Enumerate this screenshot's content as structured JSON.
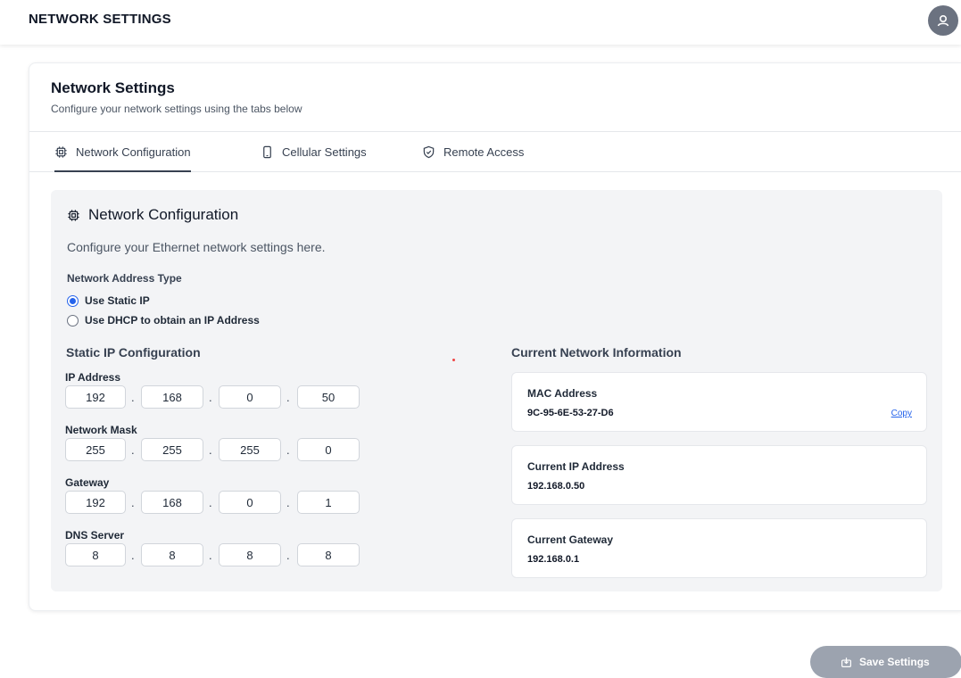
{
  "header": {
    "title": "NETWORK SETTINGS",
    "avatar_icon": "user-icon"
  },
  "card": {
    "title": "Network Settings",
    "subtitle": "Configure your network settings using the tabs below"
  },
  "tabs": [
    {
      "label": "Network Configuration",
      "icon": "chip-icon",
      "active": true
    },
    {
      "label": "Cellular Settings",
      "icon": "phone-icon",
      "active": false
    },
    {
      "label": "Remote Access",
      "icon": "shield-icon",
      "active": false
    }
  ],
  "panel": {
    "title": "Network Configuration",
    "description": "Configure your Ethernet network settings here."
  },
  "address_type": {
    "label": "Network Address Type",
    "options": [
      {
        "label": "Use Static IP",
        "checked": true
      },
      {
        "label": "Use DHCP to obtain an IP Address",
        "checked": false
      }
    ]
  },
  "static_ip": {
    "heading": "Static IP Configuration",
    "fields": [
      {
        "label": "IP Address",
        "octets": [
          "192",
          "168",
          "0",
          "50"
        ]
      },
      {
        "label": "Network Mask",
        "octets": [
          "255",
          "255",
          "255",
          "0"
        ]
      },
      {
        "label": "Gateway",
        "octets": [
          "192",
          "168",
          "0",
          "1"
        ]
      },
      {
        "label": "DNS Server",
        "octets": [
          "8",
          "8",
          "8",
          "8"
        ]
      }
    ],
    "separator": "."
  },
  "current_info": {
    "heading": "Current Network Information",
    "mac": {
      "label": "MAC Address",
      "value": "9C-95-6E-53-27-D6",
      "copy_label": "Copy"
    },
    "ip": {
      "label": "Current IP Address",
      "value": "192.168.0.50"
    },
    "gateway": {
      "label": "Current Gateway",
      "value": "192.168.0.1"
    }
  },
  "footer": {
    "save_label": "Save Settings",
    "save_icon": "save-icon"
  },
  "colors": {
    "accent": "#2563eb",
    "button_disabled": "#9ca3af",
    "panel_bg": "#f3f4f6"
  }
}
